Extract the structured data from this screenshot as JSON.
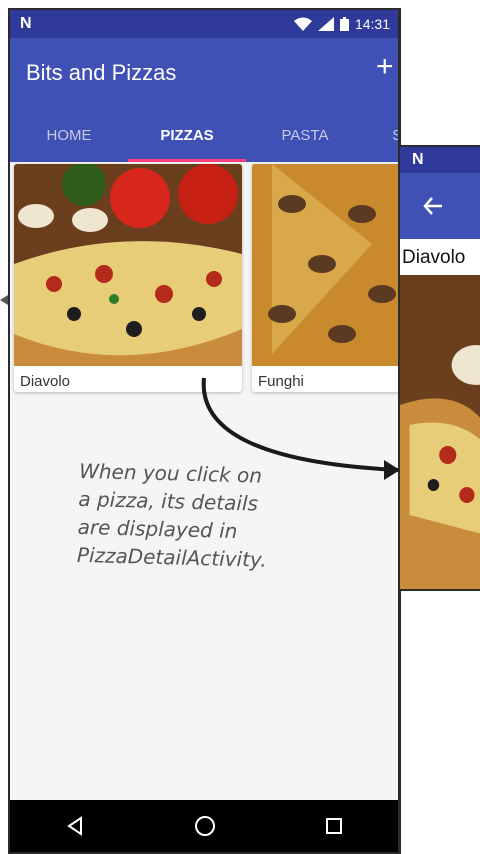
{
  "status_bar": {
    "time": "14:31"
  },
  "app_bar": {
    "title": "Bits and Pizzas",
    "add_icon": "add-icon",
    "share_icon": "share-icon"
  },
  "tabs": [
    {
      "label": "HOME",
      "active": false
    },
    {
      "label": "PIZZAS",
      "active": true
    },
    {
      "label": "PASTA",
      "active": false
    },
    {
      "label": "STORES",
      "active": false
    }
  ],
  "pizzas": [
    {
      "name": "Diavolo"
    },
    {
      "name": "Funghi"
    }
  ],
  "nav_bar": {
    "back_icon": "back-triangle-icon",
    "home_icon": "home-circle-icon",
    "recents_icon": "recents-square-icon"
  },
  "detail_screen": {
    "back_icon": "arrow-left-icon",
    "pizza_name": "Diavolo"
  },
  "annotation": {
    "lines": [
      "When you click on",
      "a pizza, its details",
      "are displayed in",
      "PizzaDetailActivity."
    ]
  },
  "colors": {
    "primary": "#3f51b5",
    "primary_dark": "#2f3a9a",
    "accent": "#ff4081"
  }
}
